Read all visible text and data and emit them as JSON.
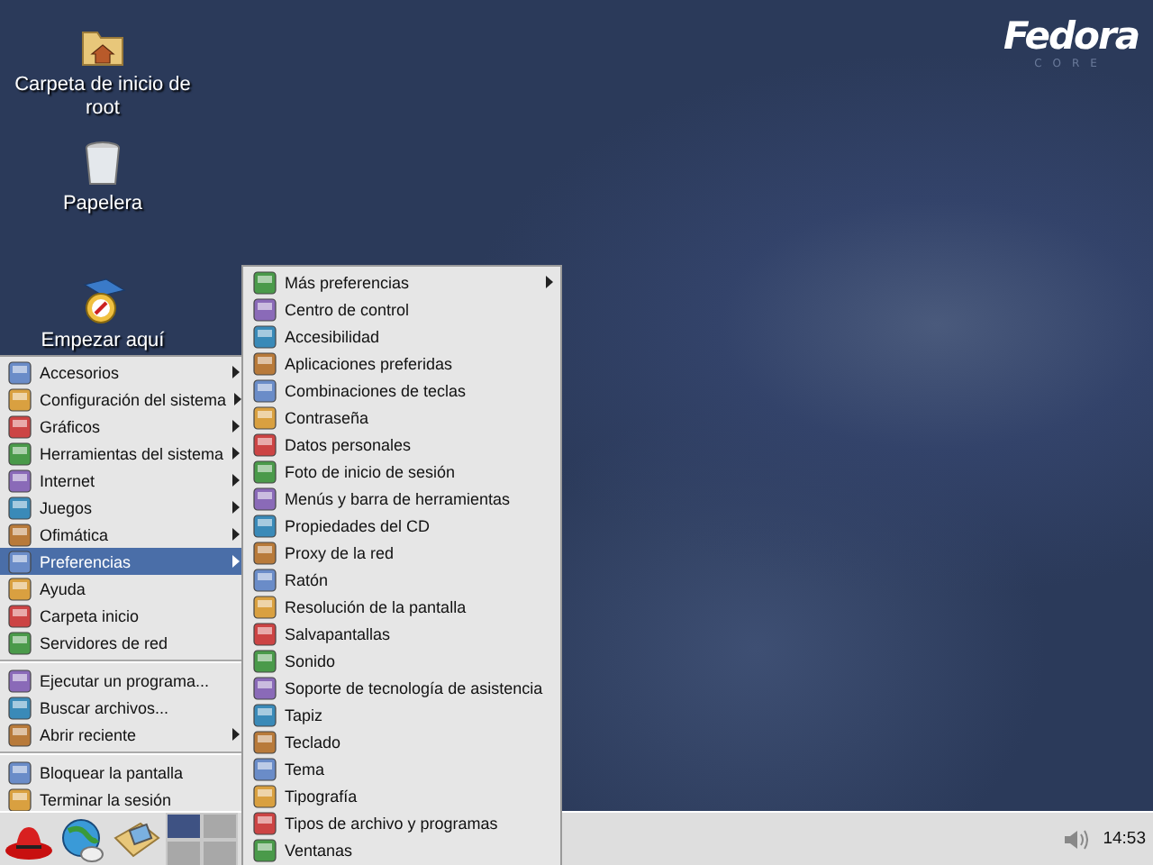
{
  "desktop": {
    "logo": "Fedora",
    "logo_subtitle": "CORE",
    "icons": [
      {
        "label": "Carpeta de inicio de root",
        "kind": "folder"
      },
      {
        "label": "Papelera",
        "kind": "trash"
      },
      {
        "label": "Empezar aquí",
        "kind": "start"
      }
    ]
  },
  "main_menu": {
    "sections": [
      [
        {
          "label": "Accesorios",
          "submenu": true,
          "selected": false
        },
        {
          "label": "Configuración del sistema",
          "submenu": true,
          "selected": false
        },
        {
          "label": "Gráficos",
          "submenu": true,
          "selected": false
        },
        {
          "label": "Herramientas del sistema",
          "submenu": true,
          "selected": false
        },
        {
          "label": "Internet",
          "submenu": true,
          "selected": false
        },
        {
          "label": "Juegos",
          "submenu": true,
          "selected": false
        },
        {
          "label": "Ofimática",
          "submenu": true,
          "selected": false
        },
        {
          "label": "Preferencias",
          "submenu": true,
          "selected": true
        },
        {
          "label": "Ayuda",
          "submenu": false,
          "selected": false
        },
        {
          "label": "Carpeta inicio",
          "submenu": false,
          "selected": false
        },
        {
          "label": "Servidores de red",
          "submenu": false,
          "selected": false
        }
      ],
      [
        {
          "label": "Ejecutar un programa...",
          "submenu": false,
          "selected": false
        },
        {
          "label": "Buscar archivos...",
          "submenu": false,
          "selected": false
        },
        {
          "label": "Abrir reciente",
          "submenu": true,
          "selected": false
        }
      ],
      [
        {
          "label": "Bloquear la pantalla",
          "submenu": false,
          "selected": false
        },
        {
          "label": "Terminar la sesión",
          "submenu": false,
          "selected": false
        }
      ]
    ]
  },
  "submenu": {
    "items": [
      {
        "label": "Más preferencias",
        "submenu": true
      },
      {
        "label": "Centro de control",
        "submenu": false
      },
      {
        "label": "Accesibilidad",
        "submenu": false
      },
      {
        "label": "Aplicaciones preferidas",
        "submenu": false
      },
      {
        "label": "Combinaciones de teclas",
        "submenu": false
      },
      {
        "label": "Contraseña",
        "submenu": false
      },
      {
        "label": "Datos personales",
        "submenu": false
      },
      {
        "label": "Foto de inicio de sesión",
        "submenu": false
      },
      {
        "label": "Menús y barra de herramientas",
        "submenu": false
      },
      {
        "label": "Propiedades del CD",
        "submenu": false
      },
      {
        "label": "Proxy de la red",
        "submenu": false
      },
      {
        "label": "Ratón",
        "submenu": false
      },
      {
        "label": "Resolución de la pantalla",
        "submenu": false
      },
      {
        "label": "Salvapantallas",
        "submenu": false
      },
      {
        "label": "Sonido",
        "submenu": false
      },
      {
        "label": "Soporte de tecnología de asistencia",
        "submenu": false
      },
      {
        "label": "Tapiz",
        "submenu": false
      },
      {
        "label": "Teclado",
        "submenu": false
      },
      {
        "label": "Tema",
        "submenu": false
      },
      {
        "label": "Tipografía",
        "submenu": false
      },
      {
        "label": "Tipos de archivo y programas",
        "submenu": false
      },
      {
        "label": "Ventanas",
        "submenu": false
      }
    ]
  },
  "taskbar": {
    "workspaces": [
      {
        "selected": true
      },
      {
        "selected": false
      },
      {
        "selected": false
      },
      {
        "selected": false
      }
    ],
    "clock": "14:53"
  }
}
